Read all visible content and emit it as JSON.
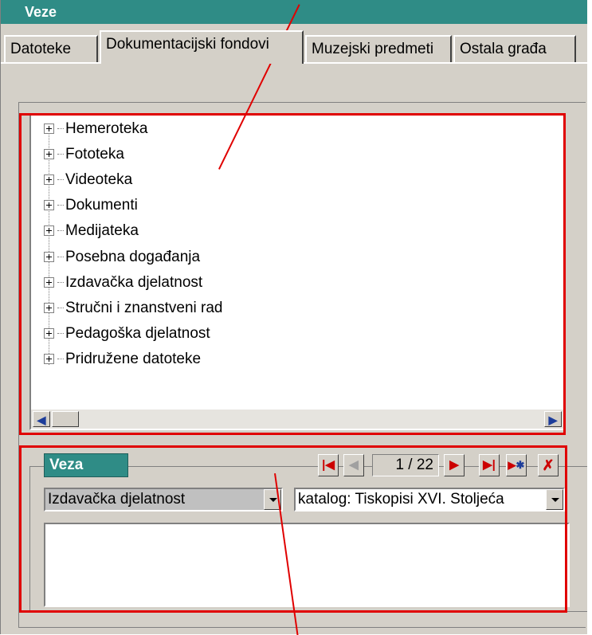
{
  "window": {
    "title": "Veze"
  },
  "tabs": [
    {
      "label": "Datoteke"
    },
    {
      "label": "Dokumentacijski fondovi"
    },
    {
      "label": "Muzejski predmeti"
    },
    {
      "label": "Ostala građa"
    }
  ],
  "tree": {
    "items": [
      {
        "label": "Hemeroteka"
      },
      {
        "label": "Fototeka"
      },
      {
        "label": "Videoteka"
      },
      {
        "label": "Dokumenti"
      },
      {
        "label": "Medijateka"
      },
      {
        "label": "Posebna događanja"
      },
      {
        "label": "Izdavačka djelatnost"
      },
      {
        "label": "Stručni i znanstveni rad"
      },
      {
        "label": "Pedagoška djelatnost"
      },
      {
        "label": "Pridružene datoteke"
      }
    ]
  },
  "veza_panel": {
    "title": "Veza",
    "record_counter": "1 / 22",
    "category_select": "Izdavačka djelatnost",
    "item_select": "katalog: Tiskopisi XVI. Stoljeća",
    "note_text": ""
  },
  "icons": {
    "first": "first-record-icon",
    "prev": "previous-record-icon",
    "next": "next-record-icon",
    "last": "last-record-icon",
    "new": "new-record-icon",
    "delete": "delete-record-icon"
  },
  "colors": {
    "titlebar": "#2f8c86",
    "annotation": "#e00000",
    "nav_red": "#cc0000",
    "nav_blue": "#1d3d9a"
  }
}
